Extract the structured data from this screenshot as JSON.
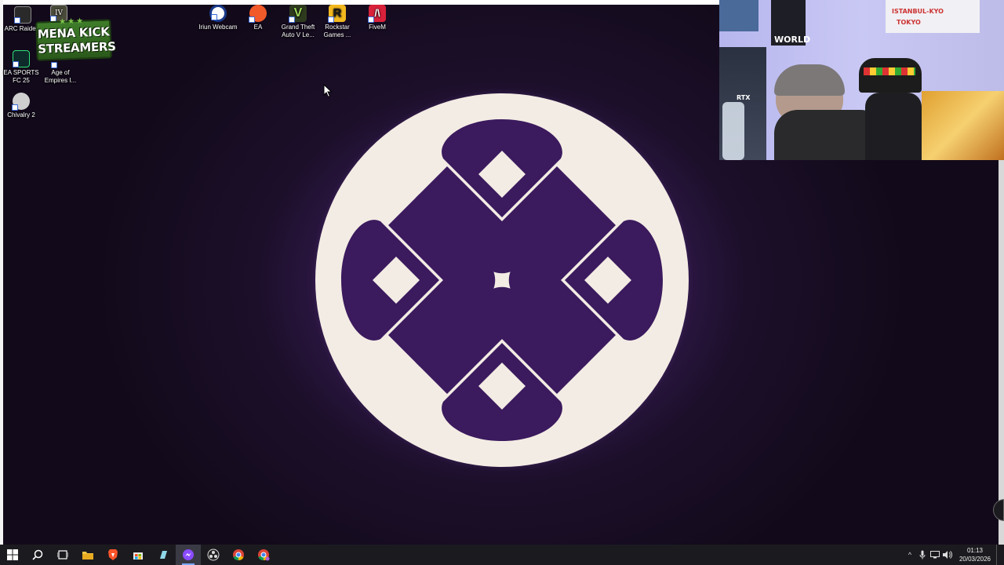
{
  "desktop": {
    "icons_left": [
      {
        "label": "ARC Raiders"
      },
      {
        "label": "IV"
      },
      {
        "label": "EA SPORTS FC 25"
      },
      {
        "label": "Age of Empires I..."
      },
      {
        "label": "Chivalry 2"
      }
    ],
    "icons_top": [
      {
        "label": "Iriun Webcam"
      },
      {
        "label": "EA"
      },
      {
        "label": "Grand Theft Auto V Le..."
      },
      {
        "label": "Rockstar Games ..."
      },
      {
        "label": "FiveM"
      }
    ],
    "badge": {
      "line1": "MENA KICK",
      "line2": "STREAMERS",
      "stars": "★★★"
    }
  },
  "webcam": {
    "caption_world": "WORLD",
    "caption_istanbul": "ISTANBUL-KYO",
    "caption_tokyo": "TOKYO",
    "caption_rtx": "RTX"
  },
  "taskbar": {
    "pinned": [
      "start-icon",
      "search-icon",
      "task-view-icon",
      "file-explorer-icon",
      "brave-browser-icon",
      "store-icon",
      "notepad-icon",
      "messenger-icon",
      "obs-icon",
      "chrome-icon",
      "chrome-profile-icon"
    ],
    "time": "01:13",
    "date": "20/03/2026",
    "tray_chevron": "^"
  },
  "colors": {
    "accent_purple": "#3b1a5e",
    "logo_cream": "#f3ece4",
    "taskbar": "#1b1b1f"
  }
}
